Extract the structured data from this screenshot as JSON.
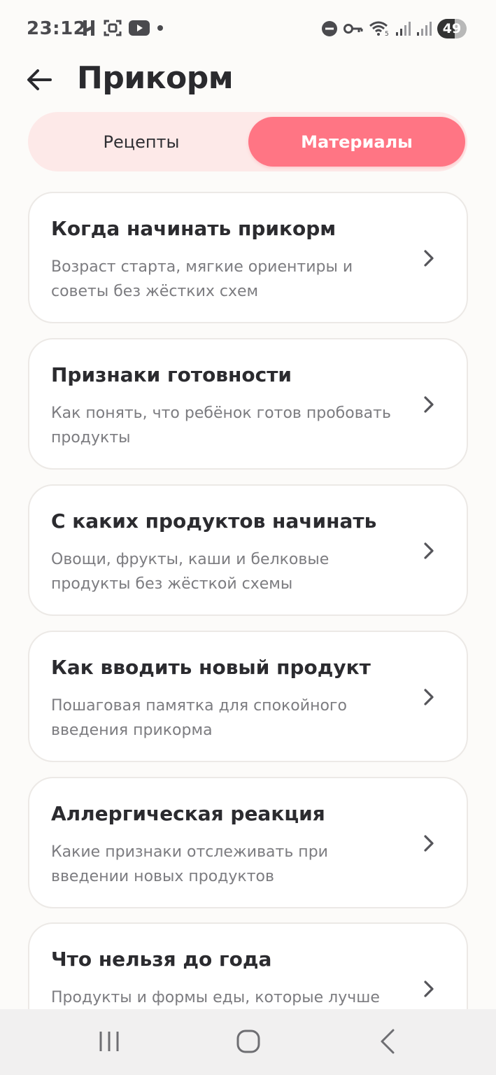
{
  "status_bar": {
    "time": "23:12",
    "battery": "49",
    "left_icons": [
      "app-icon",
      "screen-capture-icon",
      "youtube-icon",
      "dot-icon"
    ],
    "right_icons": [
      "do-not-disturb-icon",
      "vpn-key-icon",
      "wifi-icon",
      "signal-icon",
      "signal-icon"
    ]
  },
  "header": {
    "title": "Прикорм"
  },
  "tabs": {
    "recipes": "Рецепты",
    "materials": "Материалы",
    "active": "materials"
  },
  "articles": [
    {
      "title": "Когда начинать прикорм",
      "description": "Возраст старта, мягкие ориентиры и советы без жёстких схем"
    },
    {
      "title": "Признаки готовности",
      "description": "Как понять, что ребёнок готов пробовать продукты"
    },
    {
      "title": "С каких продуктов начинать",
      "description": "Овощи, фрукты, каши и белковые продукты без жёсткой схемы"
    },
    {
      "title": "Как вводить новый продукт",
      "description": "Пошаговая памятка для спокойного введения прикорма"
    },
    {
      "title": "Аллергическая реакция",
      "description": "Какие признаки отслеживать при введении новых продуктов"
    },
    {
      "title": "Что нельзя до года",
      "description": "Продукты и формы еды, которые лучше"
    }
  ],
  "colors": {
    "accent": "#ff7584",
    "tab_bg": "#fde9e8",
    "background": "#fcfbf9"
  }
}
